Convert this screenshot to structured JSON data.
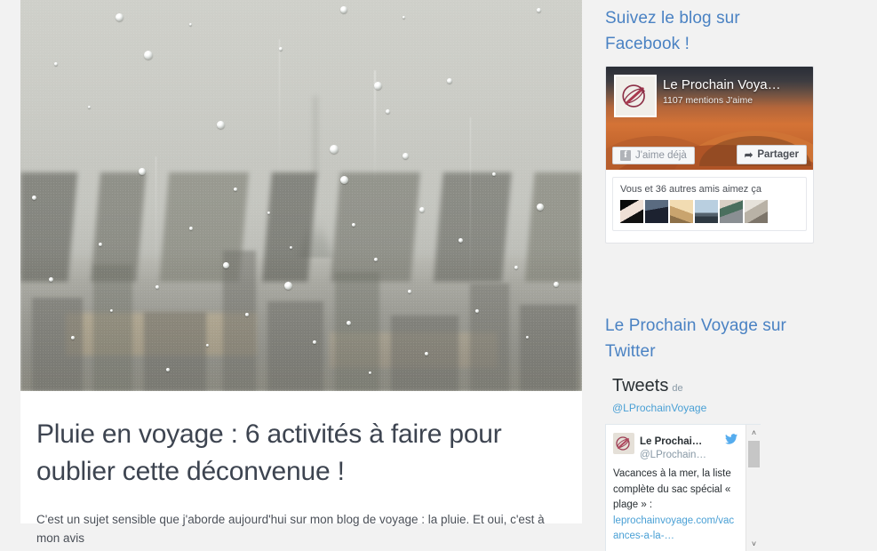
{
  "article": {
    "title": "Pluie en voyage : 6 activités à faire pour oublier cette déconvenue !",
    "paragraph": "C'est un sujet sensible que j'aborde aujourd'hui sur mon blog de voyage : la pluie. Et oui, c'est à mon avis",
    "hero_alt": "Toits de Paris et Tour Eiffel sous la pluie vus à travers une vitre"
  },
  "sidebar": {
    "facebook": {
      "widget_title": "Suivez le blog sur Facebook !",
      "page_name": "Le Prochain Voya…",
      "likes": "1107 mentions J'aime",
      "like_button": "J'aime déjà",
      "share_button": "Partager",
      "facebook_f": "f",
      "social_text": "Vous et 36 autres amis aimez ça",
      "friends_count": 6
    },
    "twitter": {
      "widget_title": "Le Prochain Voyage sur Twitter",
      "tweets_label": "Tweets",
      "de_label": "de",
      "handle": "@LProchainVoyage",
      "tweet": {
        "author_name": "Le Prochai…",
        "author_handle": "@LProchain…",
        "text": "Vacances à la mer, la liste complète du sac spécial « plage » : ",
        "link": "leprochainvoyage.com/vacances-a-la-…"
      },
      "scroll_up": "˄",
      "scroll_down": "˅"
    }
  },
  "colors": {
    "heading_blue": "#4a82c3",
    "twitter_blue": "#4aa0d5",
    "text_dark": "#3d4450",
    "page_bg": "#f2f2f2"
  }
}
